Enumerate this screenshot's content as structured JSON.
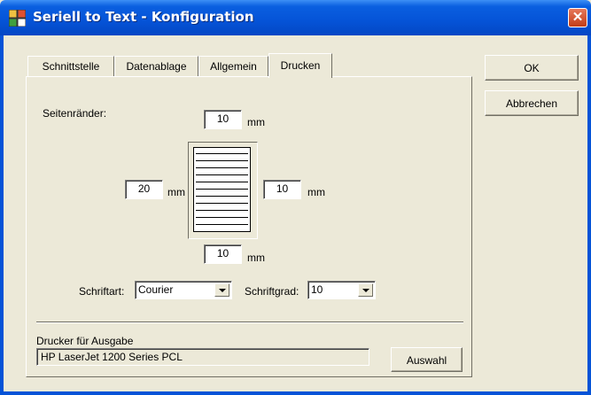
{
  "window": {
    "title": "Seriell to Text - Konfiguration",
    "close_glyph": "✕"
  },
  "tabs": [
    {
      "label": "Schnittstelle"
    },
    {
      "label": "Datenablage"
    },
    {
      "label": "Allgemein"
    },
    {
      "label": "Drucken"
    }
  ],
  "active_tab": "Drucken",
  "buttons": {
    "ok": "OK",
    "cancel": "Abbrechen",
    "select_printer": "Auswahl"
  },
  "margins": {
    "label": "Seitenränder:",
    "unit": "mm",
    "top": "10",
    "left": "20",
    "right": "10",
    "bottom": "10"
  },
  "font": {
    "family_label": "Schriftart:",
    "family_value": "Courier",
    "size_label": "Schriftgrad:",
    "size_value": "10"
  },
  "printer": {
    "label": "Drucker für Ausgabe",
    "value": "HP LaserJet 1200 Series PCL"
  },
  "colors": {
    "titlebar": "#0553d7",
    "dialog_bg": "#ece9d8",
    "close_button": "#c23c17"
  }
}
